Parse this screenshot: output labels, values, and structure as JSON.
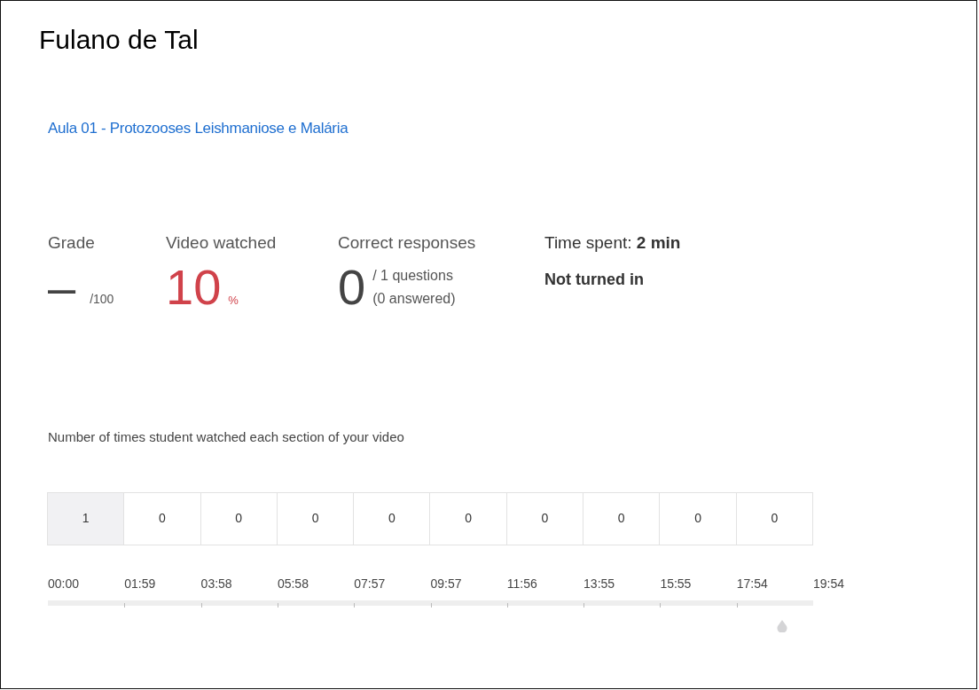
{
  "student": {
    "name": "Fulano de Tal"
  },
  "lesson": {
    "title": "Aula 01 - Protozooses Leishmaniose e Malária"
  },
  "stats": {
    "grade": {
      "label": "Grade",
      "value": "–",
      "suffix": "/100"
    },
    "video": {
      "label": "Video watched",
      "value": "10",
      "suffix": "%"
    },
    "responses": {
      "label": "Correct responses",
      "value": "0",
      "questions": "/ 1 questions",
      "answered": "(0 answered)"
    },
    "time": {
      "label": "Time spent:",
      "value": "2 min"
    },
    "status": "Not turned in"
  },
  "heatmap": {
    "title": "Number of times student watched each section of your video",
    "sections": [
      {
        "count": "1",
        "watched": true
      },
      {
        "count": "0",
        "watched": false
      },
      {
        "count": "0",
        "watched": false
      },
      {
        "count": "0",
        "watched": false
      },
      {
        "count": "0",
        "watched": false
      },
      {
        "count": "0",
        "watched": false
      },
      {
        "count": "0",
        "watched": false
      },
      {
        "count": "0",
        "watched": false
      },
      {
        "count": "0",
        "watched": false
      },
      {
        "count": "0",
        "watched": false
      }
    ],
    "times": [
      "00:00",
      "01:59",
      "03:58",
      "05:58",
      "07:57",
      "09:57",
      "11:56",
      "13:55",
      "15:55",
      "17:54",
      "19:54"
    ],
    "playhead": {
      "level": 0.96
    }
  }
}
